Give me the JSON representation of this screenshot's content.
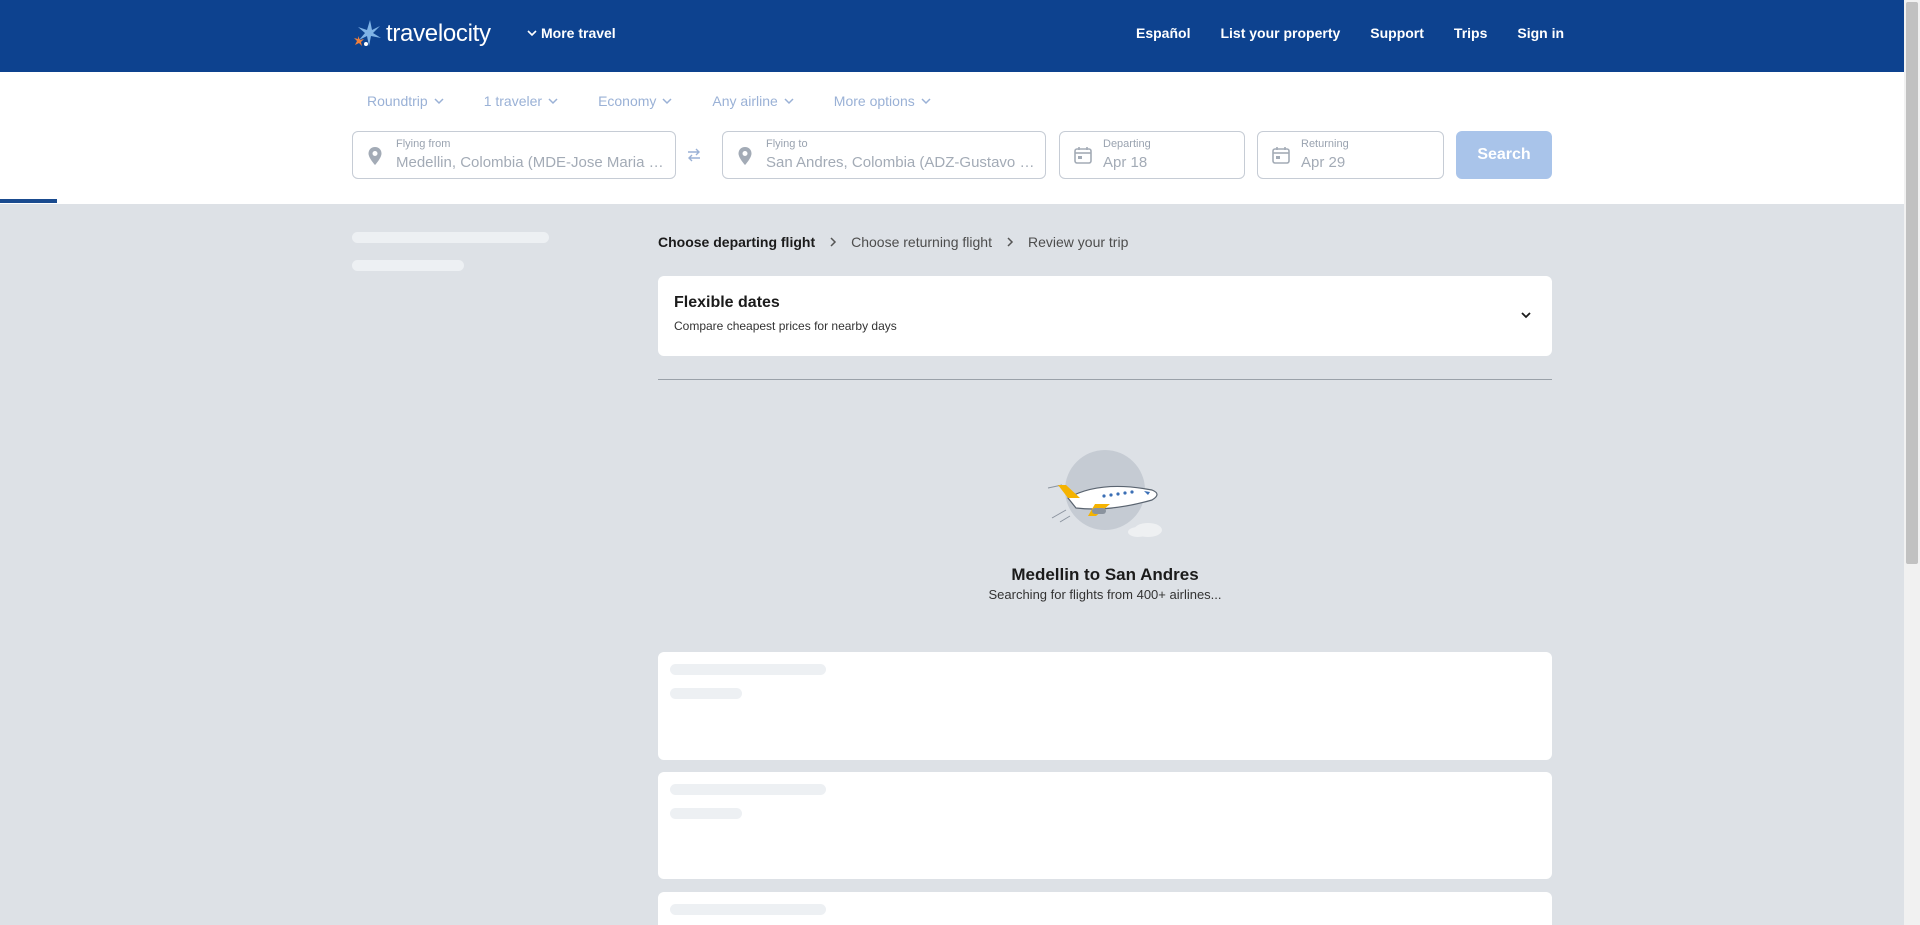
{
  "header": {
    "logo_text": "travelocity",
    "more_travel": "More travel",
    "nav": [
      "Español",
      "List your property",
      "Support",
      "Trips",
      "Sign in"
    ]
  },
  "search": {
    "filters": [
      "Roundtrip",
      "1 traveler",
      "Economy",
      "Any airline",
      "More options"
    ],
    "from_label": "Flying from",
    "from_value": "Medellin, Colombia (MDE-Jose Maria Cordova Intl.)",
    "to_label": "Flying to",
    "to_value": "San Andres, Colombia (ADZ-Gustavo Rojas Pinilla Intl.)",
    "depart_label": "Departing",
    "depart_value": "Apr 18",
    "return_label": "Returning",
    "return_value": "Apr 29",
    "search_label": "Search"
  },
  "breadcrumb": {
    "step1": "Choose departing flight",
    "step2": "Choose returning flight",
    "step3": "Review your trip"
  },
  "flexible": {
    "title": "Flexible dates",
    "subtitle": "Compare cheapest prices for nearby days"
  },
  "loading": {
    "title": "Medellin to San Andres",
    "subtitle": "Searching for flights from 400+ airlines..."
  },
  "colors": {
    "header_bg": "#0d428f",
    "page_bg": "#dde1e6",
    "search_button_bg": "#a9c4ea",
    "plane_accent": "#f5b301"
  }
}
